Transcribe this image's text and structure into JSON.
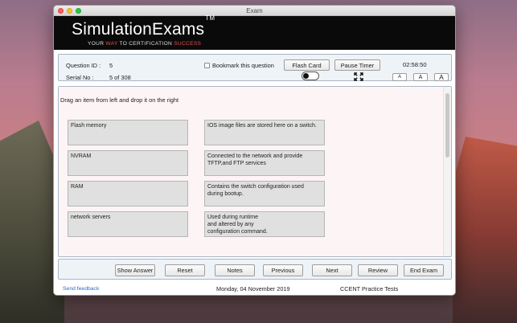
{
  "window": {
    "title": "Exam"
  },
  "brand": {
    "name": "SimulationExams",
    "tm": "TM",
    "tagline": {
      "p1": "YOUR ",
      "p2": "WAY",
      "p3": " TO CERTIFICATION ",
      "p4": "SUCCESS"
    }
  },
  "info": {
    "question_id_label": "Question ID :",
    "question_id": "5",
    "serial_label": "Serial No :",
    "serial": "5 of 308",
    "bookmark_label": "Bookmark this question",
    "flash_card": "Flash Card",
    "pause_timer": "Pause Timer",
    "timer": "02:58:50",
    "font_small": "A",
    "font_medium": "A",
    "font_large": "A"
  },
  "content": {
    "instruction": "Drag an item from left and drop it on the right",
    "left_items": [
      "Flash memory",
      "NVRAM",
      "RAM",
      "network servers"
    ],
    "right_items": [
      "IOS image files are stored here on a switch.",
      "Connected to the network and provide\nTFTP,and FTP services",
      "Contains the switch configuration used\nduring bootup.",
      "Used during runtime\nand altered by any\nconfiguration command."
    ]
  },
  "buttons": {
    "show_answer": "Show Answer",
    "reset": "Reset",
    "notes": "Notes",
    "previous": "Previous",
    "next": "Next",
    "review": "Review",
    "end_exam": "End Exam"
  },
  "footer": {
    "feedback": "Send feedback",
    "date": "Monday, 04 November 2019",
    "product": "CCENT Practice Tests"
  }
}
